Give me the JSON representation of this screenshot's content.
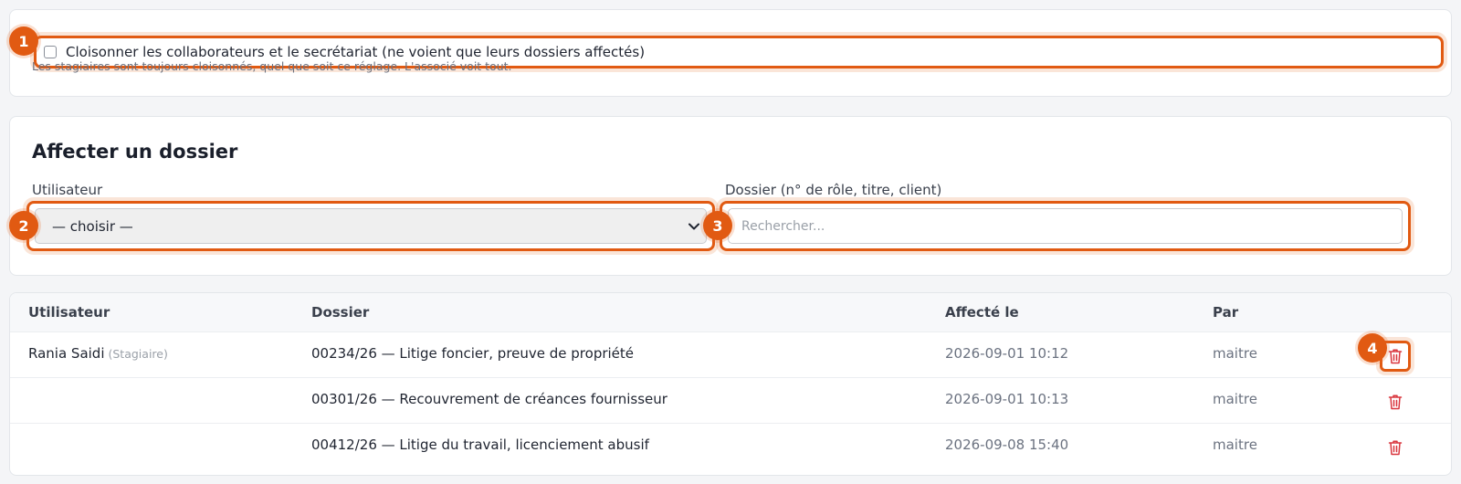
{
  "partition": {
    "label": "Cloisonner les collaborateurs et le secrétariat (ne voient que leurs dossiers affectés)",
    "hint": "Les stagiaires sont toujours cloisonnés, quel que soit ce réglage. L'associé voit tout.",
    "checked": false
  },
  "assign": {
    "title": "Affecter un dossier",
    "user_label": "Utilisateur",
    "user_value": "— choisir —",
    "dossier_label": "Dossier (n° de rôle, titre, client)",
    "search_placeholder": "Rechercher..."
  },
  "table": {
    "headers": [
      "Utilisateur",
      "Dossier",
      "Affecté le",
      "Par"
    ],
    "rows": [
      {
        "user": "Rania Saidi",
        "role": "(Stagiaire)",
        "dossier": "00234/26 — Litige foncier, preuve de propriété",
        "date": "2026-09-01 10:12",
        "by": "maitre"
      },
      {
        "user": "",
        "role": "",
        "dossier": "00301/26 — Recouvrement de créances fournisseur",
        "date": "2026-09-01 10:13",
        "by": "maitre"
      },
      {
        "user": "",
        "role": "",
        "dossier": "00412/26 — Litige du travail, licenciement abusif",
        "date": "2026-09-08 15:40",
        "by": "maitre"
      }
    ]
  },
  "badges": [
    "1",
    "2",
    "3",
    "4"
  ],
  "colors": {
    "accent": "#e15a12",
    "delete": "#d9363e"
  },
  "icons": {
    "delete": "trash-icon",
    "select": "chevron-down-icon"
  }
}
